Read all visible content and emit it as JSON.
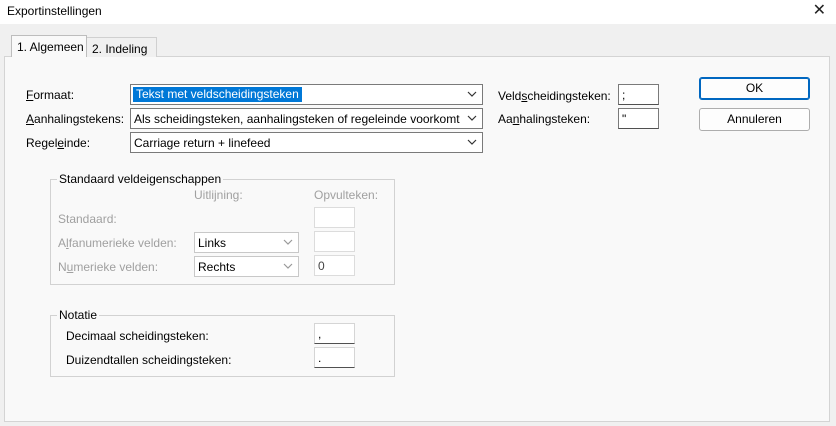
{
  "window": {
    "title": "Exportinstellingen",
    "close_glyph": "✕"
  },
  "tabs": [
    {
      "label": "1. Algemeen",
      "active": true
    },
    {
      "label": "2. Indeling",
      "active": false
    }
  ],
  "format": {
    "label_underlined": "F",
    "label_rest": "ormaat:",
    "value": "Tekst met veldscheidingsteken"
  },
  "quotes": {
    "label_underlined": "A",
    "label_rest": "anhalingstekens:",
    "value": "Als scheidingsteken, aanhalingsteken of regeleinde voorkomt"
  },
  "line_end": {
    "label_pre": "Regel",
    "label_underlined": "e",
    "label_rest": "inde:",
    "value": "Carriage return + linefeed"
  },
  "field_separator": {
    "label_pre": "Veld",
    "label_underlined": "s",
    "label_rest": "cheidingsteken:",
    "value": ";"
  },
  "quote_char": {
    "label_pre": "Aa",
    "label_underlined": "n",
    "label_rest": "halingsteken:",
    "value": "\""
  },
  "buttons": {
    "ok": "OK",
    "cancel": "Annuleren"
  },
  "standard_props": {
    "legend": "Standaard veldeigenschappen",
    "col_alignment": "Uitlijning:",
    "col_padding": "Opvulteken:",
    "row_standard": "Standaard:",
    "row_alpha_pre": "A",
    "row_alpha_underlined": "l",
    "row_alpha_rest": "fanumerieke velden:",
    "alpha_alignment": "Links",
    "row_numeric_pre": "N",
    "row_numeric_underlined": "u",
    "row_numeric_rest": "merieke velden:",
    "numeric_alignment": "Rechts",
    "numeric_padding": "0"
  },
  "notation": {
    "legend": "Notatie",
    "decimal_label": "Decimaal scheidingsteken:",
    "decimal_value": ",",
    "thousands_label": "Duizendtallen scheidingsteken:",
    "thousands_value": "."
  },
  "colors": {
    "selection": "#0078d7",
    "default_button_border": "#0067c0"
  },
  "icons": {
    "dropdown": "chevron-down-icon",
    "close": "close-icon"
  }
}
